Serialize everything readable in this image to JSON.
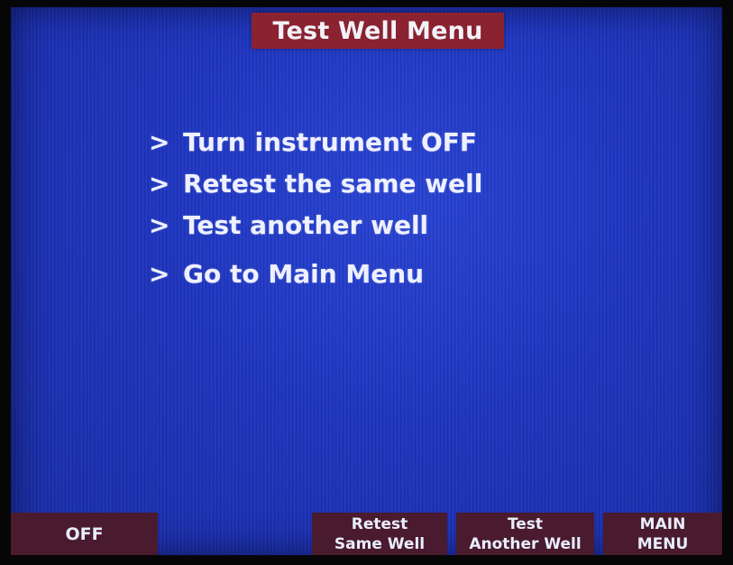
{
  "title": "Test Well Menu",
  "menu": {
    "items": [
      {
        "arrow": ">",
        "label": "Turn instrument OFF"
      },
      {
        "arrow": ">",
        "label": "Retest the same well"
      },
      {
        "arrow": ">",
        "label": "Test another well"
      },
      {
        "arrow": ">",
        "label": "Go to Main Menu"
      }
    ]
  },
  "softkeys": {
    "off": {
      "line1": "OFF"
    },
    "retest": {
      "line1": "Retest",
      "line2": "Same Well"
    },
    "test_another": {
      "line1": "Test",
      "line2": "Another Well"
    },
    "main_menu": {
      "line1": "MAIN",
      "line2": "MENU"
    }
  },
  "colors": {
    "screen_background": "#1f36c2",
    "title_bar": "#8a2230",
    "softkey_background": "#4a1a2e",
    "text": "#eef0ff"
  }
}
